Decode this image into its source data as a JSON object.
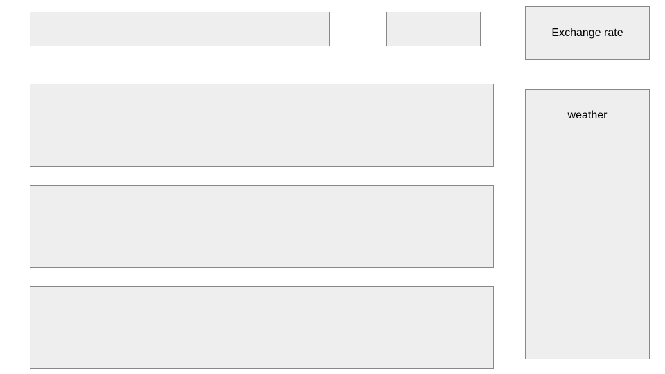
{
  "header": {
    "left_label": "",
    "right_label": ""
  },
  "sidebar": {
    "exchange_rate_label": "Exchange rate",
    "weather_label": "weather"
  },
  "rows": {
    "row1_label": "",
    "row2_label": "",
    "row3_label": ""
  }
}
